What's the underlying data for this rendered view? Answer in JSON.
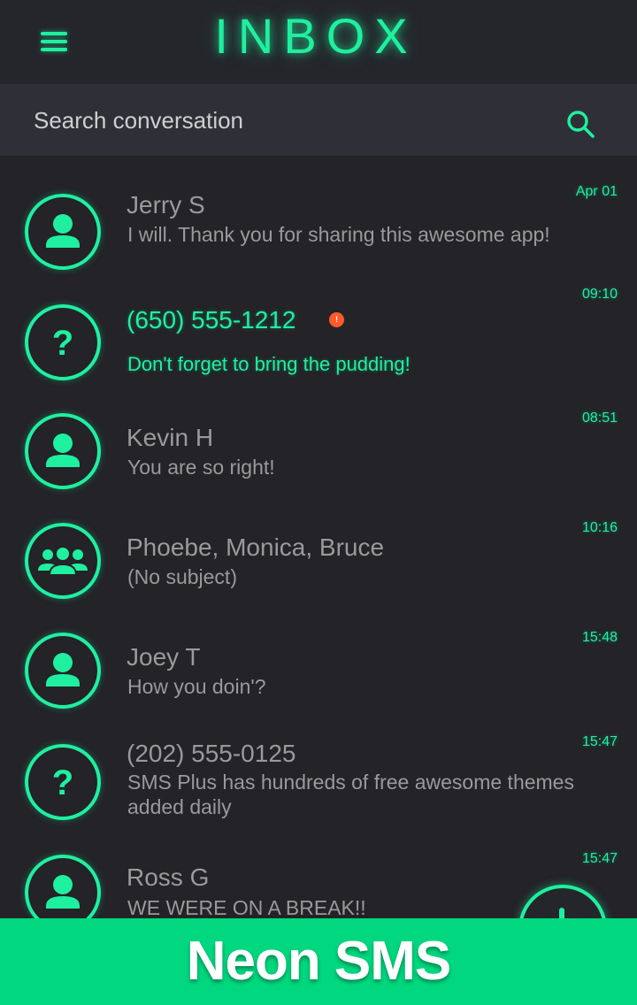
{
  "header": {
    "title": "INBOX",
    "menu_icon": "hamburger-menu-icon",
    "accent_color": "#1ef0a0"
  },
  "search": {
    "placeholder": "Search conversation",
    "icon": "search-icon"
  },
  "conversations": [
    {
      "name": "Jerry S",
      "snippet": " I will. Thank you for sharing this awesome app!",
      "time": "Apr 01",
      "avatar": "person-icon",
      "unread": false
    },
    {
      "name": "(650) 555-1212",
      "snippet": "Don't forget to bring the pudding!",
      "time": "09:10",
      "avatar": "unknown-contact-icon",
      "unread": true,
      "unread_badge": "!"
    },
    {
      "name": "Kevin H",
      "snippet": "You are so right!",
      "time": "08:51",
      "avatar": "person-icon",
      "unread": false
    },
    {
      "name": "Phoebe, Monica, Bruce",
      "snippet": "(No subject)",
      "time": "10:16",
      "avatar": "group-icon",
      "unread": false
    },
    {
      "name": "Joey T",
      "snippet": " How you doin'?",
      "time": "15:48",
      "avatar": "person-icon",
      "unread": false
    },
    {
      "name": "(202) 555-0125",
      "snippet": " SMS Plus has hundreds of free awesome themes added daily",
      "time": "15:47",
      "avatar": "unknown-contact-icon",
      "unread": false
    },
    {
      "name": "Ross G",
      "snippet": " WE WERE ON A BREAK!!",
      "time": "15:47",
      "avatar": "person-icon",
      "unread": false
    }
  ],
  "fab": {
    "icon": "plus-icon"
  },
  "banner": {
    "text": "Neon SMS",
    "color": "#00d77e"
  }
}
